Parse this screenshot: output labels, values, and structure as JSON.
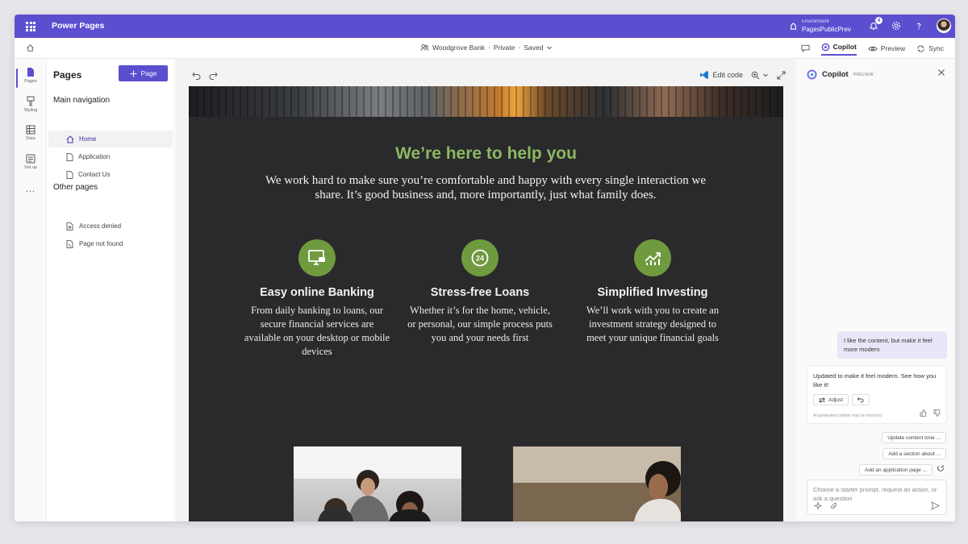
{
  "header": {
    "app_title": "Power Pages",
    "environment_label": "Environment",
    "environment_name": "PagesPublicPrev",
    "notification_count": "4"
  },
  "commandbar": {
    "site_name": "Woodgrove Bank",
    "site_visibility": "Private",
    "site_status": "Saved",
    "separator": "·",
    "copilot_label": "Copilot",
    "preview_label": "Preview",
    "sync_label": "Sync"
  },
  "rail": {
    "items": [
      {
        "label": "Pages"
      },
      {
        "label": "Styling"
      },
      {
        "label": "Data"
      },
      {
        "label": "Set up"
      }
    ],
    "more": "..."
  },
  "pages_panel": {
    "title": "Pages",
    "add_label": "Page",
    "main_nav_title": "Main navigation",
    "main_nav": [
      {
        "label": "Home"
      },
      {
        "label": "Application"
      },
      {
        "label": "Contact Us"
      }
    ],
    "other_title": "Other pages",
    "other": [
      {
        "label": "Access denied"
      },
      {
        "label": "Page not found"
      }
    ]
  },
  "canvas": {
    "edit_code_label": "Edit code",
    "heading": "We’re here to help you",
    "intro": "We work hard to make sure you’re comfortable and happy with every single interaction we share. It’s good business and, more importantly, just what family does.",
    "features": [
      {
        "title": "Easy online Banking",
        "text": "From daily banking to loans, our secure financial services are available on your desktop or mobile devices"
      },
      {
        "title": "Stress-free Loans",
        "text": "Whether it’s for the home, vehicle, or personal, our simple process puts you and your needs first"
      },
      {
        "title": "Simplified Investing",
        "text": "We’ll work with you to create an investment strategy designed to meet your unique financial goals"
      }
    ],
    "loan_icon_text": "24"
  },
  "copilot": {
    "title": "Copilot",
    "tag": "PREVIEW",
    "user_message": "I like the content, but make it feel more modern",
    "bot_message": "Updated to make it feel modern. See how you like it!",
    "adjust_label": "Adjust",
    "disclaimer": "AI-generated content may be incorrect",
    "suggestions": [
      {
        "label": "Update content tone ..."
      },
      {
        "label": "Add a section about ..."
      },
      {
        "label": "Add an application page ..."
      }
    ],
    "prompt_placeholder": "Choose a starter prompt, request an action, or ask a question"
  },
  "colors": {
    "brand": "#5b4fd0",
    "heading_green": "#8cb862",
    "icon_green": "#6f9a3e",
    "canvas_dark": "#2a2a2c"
  }
}
